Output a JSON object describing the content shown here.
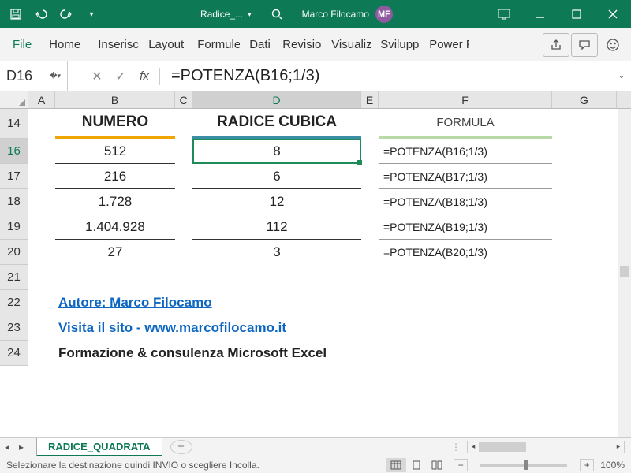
{
  "titlebar": {
    "doc_name": "Radice_...",
    "user_name": "Marco Filocamo",
    "user_initials": "MF"
  },
  "ribbon": {
    "tabs": [
      "File",
      "Home",
      "Inserisci",
      "Layout d",
      "Formule",
      "Dati",
      "Revision",
      "Visualizz",
      "Sviluppo",
      "Power P"
    ]
  },
  "fbar": {
    "namebox": "D16",
    "formula": "=POTENZA(B16;1/3)"
  },
  "cols": [
    "A",
    "B",
    "C",
    "D",
    "E",
    "F",
    "G"
  ],
  "rows": [
    "14",
    "16",
    "17",
    "18",
    "19",
    "20",
    "21",
    "22",
    "23",
    "24"
  ],
  "headers": {
    "b": "NUMERO",
    "d": "RADICE CUBICA",
    "f": "FORMULA"
  },
  "data": {
    "r16": {
      "b": "512",
      "d": "8",
      "f": "=POTENZA(B16;1/3)"
    },
    "r17": {
      "b": "216",
      "d": "6",
      "f": "=POTENZA(B17;1/3)"
    },
    "r18": {
      "b": "1.728",
      "d": "12",
      "f": "=POTENZA(B18;1/3)"
    },
    "r19": {
      "b": "1.404.928",
      "d": "112",
      "f": "=POTENZA(B19;1/3)"
    },
    "r20": {
      "b": "27",
      "d": "3",
      "f": "=POTENZA(B20;1/3)"
    }
  },
  "footer_rows": {
    "r22": "Autore: Marco Filocamo",
    "r23": "Visita il sito - www.marcofilocamo.it",
    "r24": "Formazione & consulenza Microsoft Excel"
  },
  "sheet": {
    "name": "RADICE_QUADRATA"
  },
  "statusbar": {
    "msg": "Selezionare la destinazione quindi INVIO o scegliere Incolla.",
    "zoom": "100%"
  }
}
